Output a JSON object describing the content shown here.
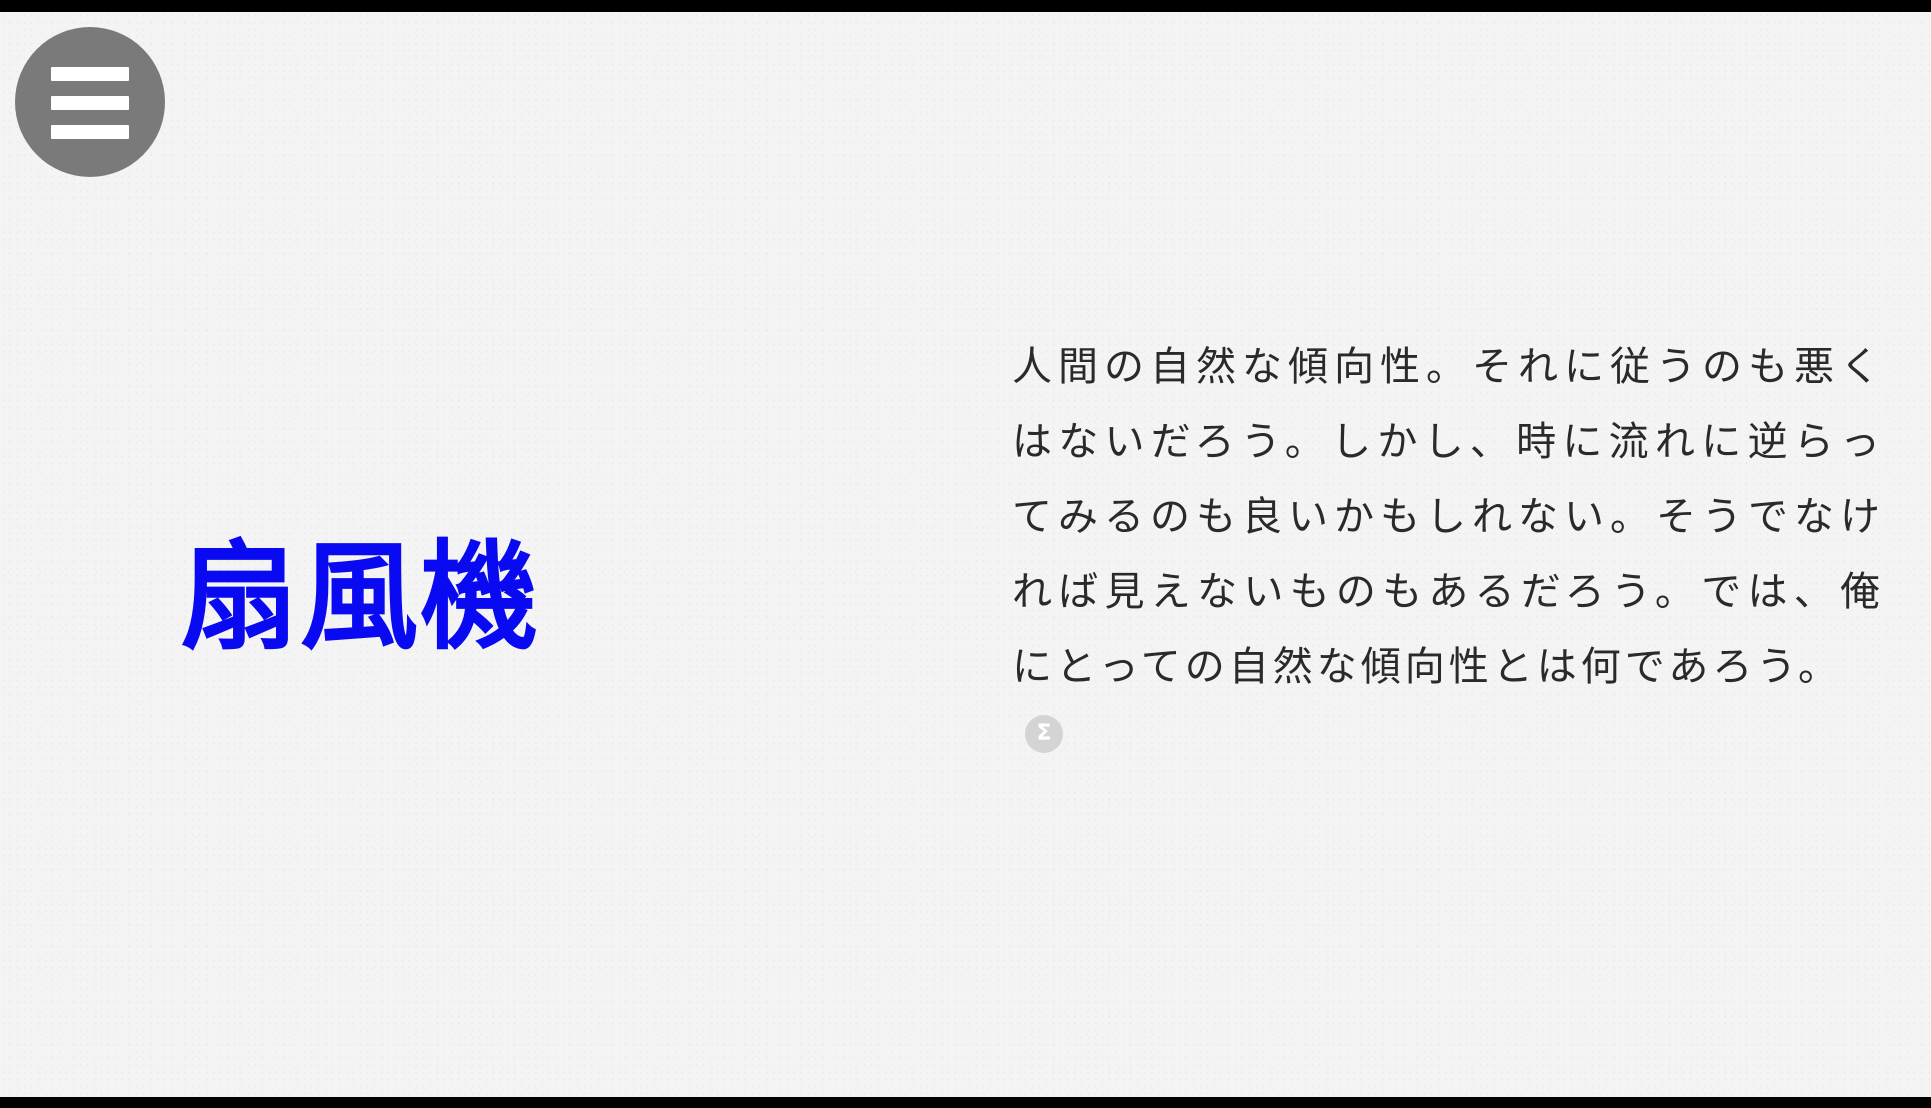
{
  "menu": {
    "icon": "hamburger-menu-icon"
  },
  "main": {
    "title": "扇風機",
    "title_color": "#0a0af2",
    "body": "人間の自然な傾向性。それに従うのも悪くはないだろう。しかし、時に流れに逆らってみるのも良いかもしれない。そうでなければ見えないものもあるだろう。では、俺にとっての自然な傾向性とは何であろう。"
  },
  "footer_icon": {
    "icon": "sigma-icon",
    "glyph": "Σ"
  }
}
